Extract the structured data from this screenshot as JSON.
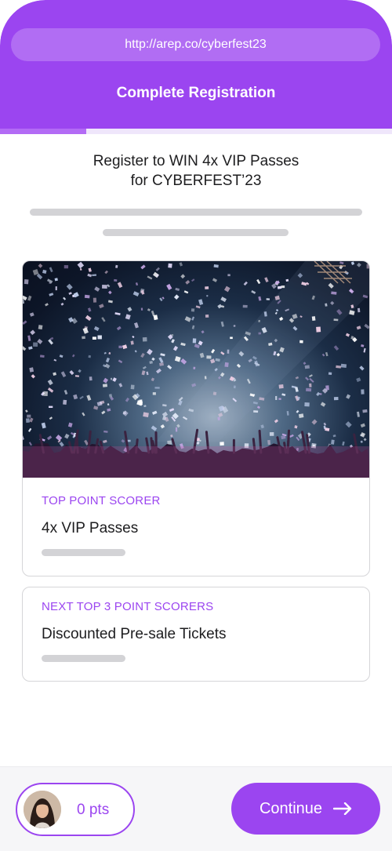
{
  "browser": {
    "url": "http://arep.co/cyberfest23"
  },
  "header": {
    "title": "Complete Registration"
  },
  "progress": {
    "fraction": 0.22
  },
  "headline": {
    "line1": "Register to WIN 4x VIP Passes",
    "line2": "for CYBERFEST’23"
  },
  "hero_image": {
    "description_icon": "concert-confetti-image"
  },
  "prizes": [
    {
      "tier": "TOP POINT SCORER",
      "prize": "4x VIP Passes"
    },
    {
      "tier": "NEXT TOP 3 POINT SCORERS",
      "prize": "Discounted Pre-sale Tickets"
    }
  ],
  "footer": {
    "points_label": "0 pts",
    "continue_label": "Continue",
    "continue_icon": "arrow-right-icon"
  },
  "colors": {
    "brand": "#9b45f0",
    "skeleton": "#d3d3d6"
  }
}
